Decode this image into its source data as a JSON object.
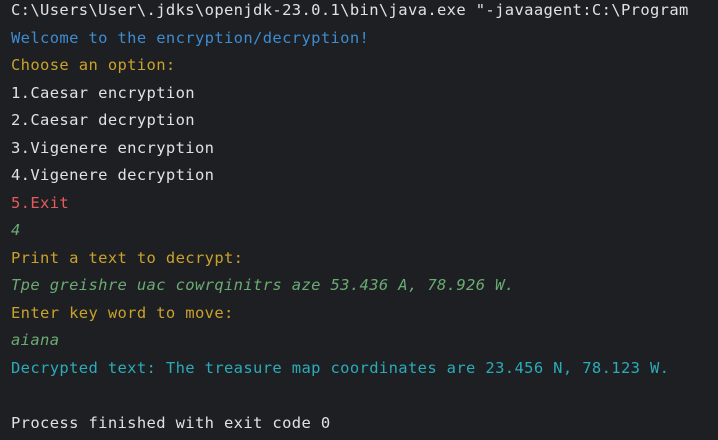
{
  "console": {
    "lines": [
      {
        "text": "C:\\Users\\User\\.jdks\\openjdk-23.0.1\\bin\\java.exe \"-javaagent:C:\\Program",
        "color": "#dfe1e5",
        "italic": false
      },
      {
        "text": "Welcome to the encryption/decryption!",
        "color": "#3d8bd1",
        "italic": false
      },
      {
        "text": "Choose an option:",
        "color": "#c9a22b",
        "italic": false
      },
      {
        "text": "1.Caesar encryption",
        "color": "#dfe1e5",
        "italic": false
      },
      {
        "text": "2.Caesar decryption",
        "color": "#dfe1e5",
        "italic": false
      },
      {
        "text": "3.Vigenere encryption",
        "color": "#dfe1e5",
        "italic": false
      },
      {
        "text": "4.Vigenere decryption",
        "color": "#dfe1e5",
        "italic": false
      },
      {
        "text": "5.Exit",
        "color": "#e55b5b",
        "italic": false
      },
      {
        "text": "4",
        "color": "#6aab73",
        "italic": true
      },
      {
        "text": "Print a text to decrypt:",
        "color": "#c9a22b",
        "italic": false
      },
      {
        "text": "Tpe greishre uac cowrqinitrs aze 53.436 A, 78.926 W.",
        "color": "#6aab73",
        "italic": true
      },
      {
        "text": "Enter key word to move:",
        "color": "#c9a22b",
        "italic": false
      },
      {
        "text": "aiana",
        "color": "#6aab73",
        "italic": true
      },
      {
        "text": "Decrypted text: The treasure map coordinates are 23.456 N, 78.123 W.",
        "color": "#2aacb8",
        "italic": false
      },
      {
        "text": "",
        "color": "#dfe1e5",
        "italic": false
      },
      {
        "text": "Process finished with exit code 0",
        "color": "#dfe1e5",
        "italic": false
      }
    ]
  }
}
